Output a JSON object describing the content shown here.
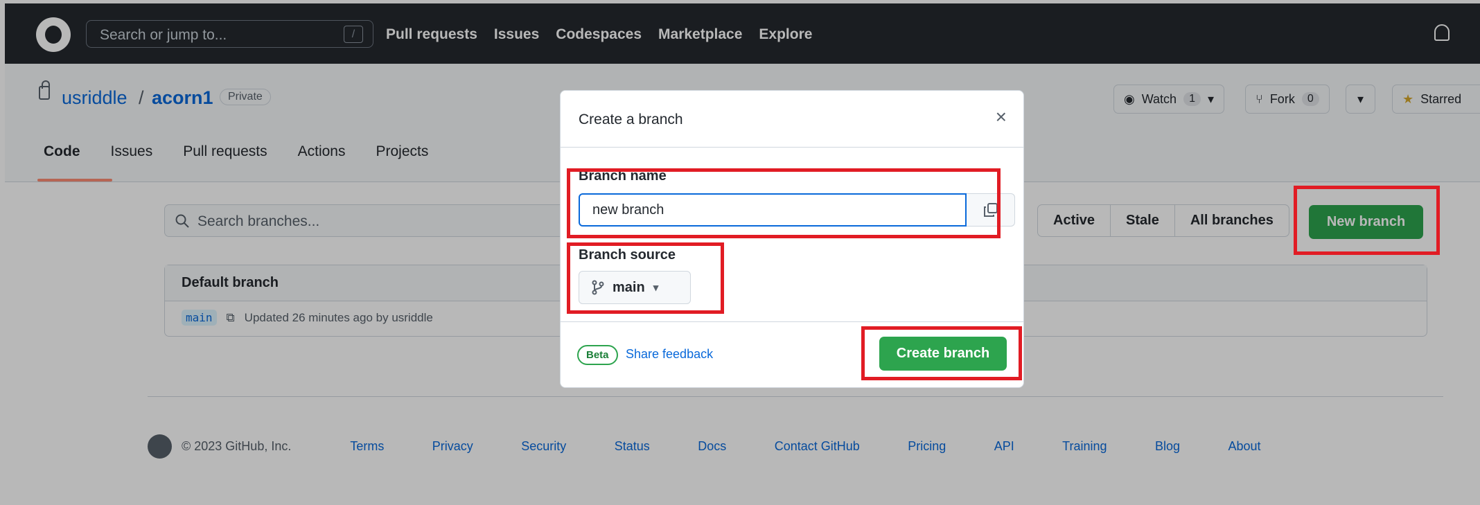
{
  "topbar": {
    "search_placeholder": "Search or jump to...",
    "search_shortcut": "/",
    "nav": [
      "Pull requests",
      "Issues",
      "Codespaces",
      "Marketplace",
      "Explore"
    ]
  },
  "repo": {
    "owner": "usriddle",
    "separator": "/",
    "name": "acorn1",
    "visibility": "Private",
    "tabs": [
      "Code",
      "Issues",
      "Pull requests",
      "Actions",
      "Projects"
    ],
    "watch_label": "Watch",
    "watch_count": "1",
    "fork_label": "Fork",
    "fork_count": "0",
    "star_label": "Starred"
  },
  "branches": {
    "search_placeholder": "Search branches...",
    "filters": [
      "Active",
      "Stale",
      "All branches"
    ],
    "new_branch_label": "New branch",
    "default_title": "Default branch",
    "default_branch": "main",
    "updated_text": "Updated 26 minutes ago by usriddle"
  },
  "footer": {
    "copyright": "© 2023 GitHub, Inc.",
    "links": [
      "Terms",
      "Privacy",
      "Security",
      "Status",
      "Docs",
      "Contact GitHub",
      "Pricing",
      "API",
      "Training",
      "Blog",
      "About"
    ]
  },
  "modal": {
    "title": "Create a branch",
    "close": "×",
    "branch_name_label": "Branch name",
    "branch_name_value": "new branch",
    "branch_source_label": "Branch source",
    "branch_source_value": "main",
    "beta": "Beta",
    "share_feedback": "Share feedback",
    "create_label": "Create branch"
  },
  "colors": {
    "primary_green": "#2da44e",
    "link_blue": "#0969da",
    "annotation_red": "#e11c24",
    "header_dark": "#24292f"
  }
}
